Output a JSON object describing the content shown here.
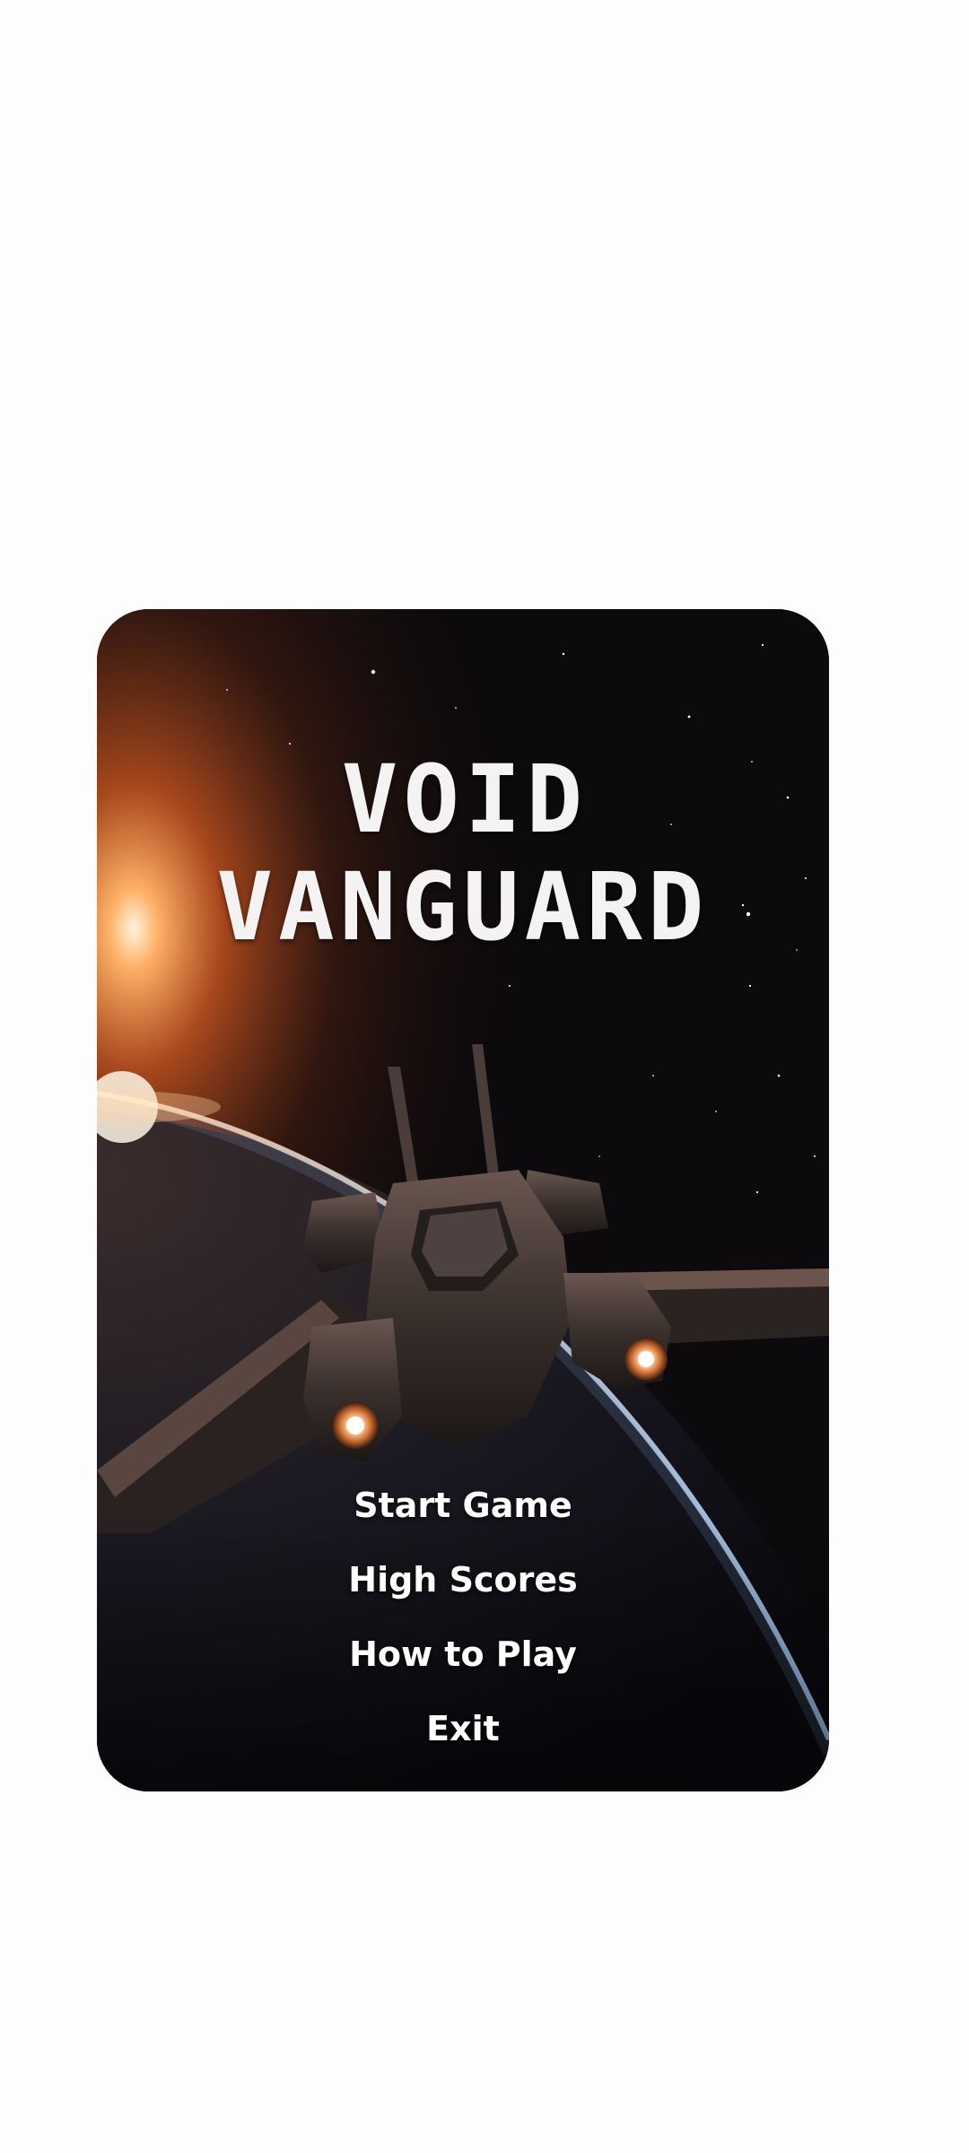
{
  "game": {
    "title_line1": "VOID",
    "title_line2": "VANGUARD"
  },
  "menu": {
    "items": [
      {
        "label": "Start Game"
      },
      {
        "label": "High Scores"
      },
      {
        "label": "How to Play"
      },
      {
        "label": "Exit"
      }
    ]
  },
  "colors": {
    "space": "#0c0a0c",
    "sun_glow": "#ff8a3a",
    "planet_rim": "#cfe4ff",
    "ship_hull": "#3a302c",
    "engine_glow": "#ffd2a0",
    "text": "#ffffff"
  }
}
